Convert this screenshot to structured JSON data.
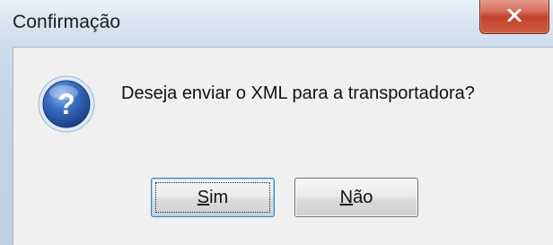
{
  "dialog": {
    "title": "Confirmação",
    "message": "Deseja enviar o XML para a transportadora?",
    "icon": "question-icon",
    "close_icon": "close-icon"
  },
  "buttons": {
    "yes": {
      "mnemonic": "S",
      "rest": "im"
    },
    "no": {
      "mnemonic": "N",
      "rest": "ão"
    }
  },
  "colors": {
    "close_button": "#c4412b",
    "icon_blue": "#2f5fb0"
  }
}
